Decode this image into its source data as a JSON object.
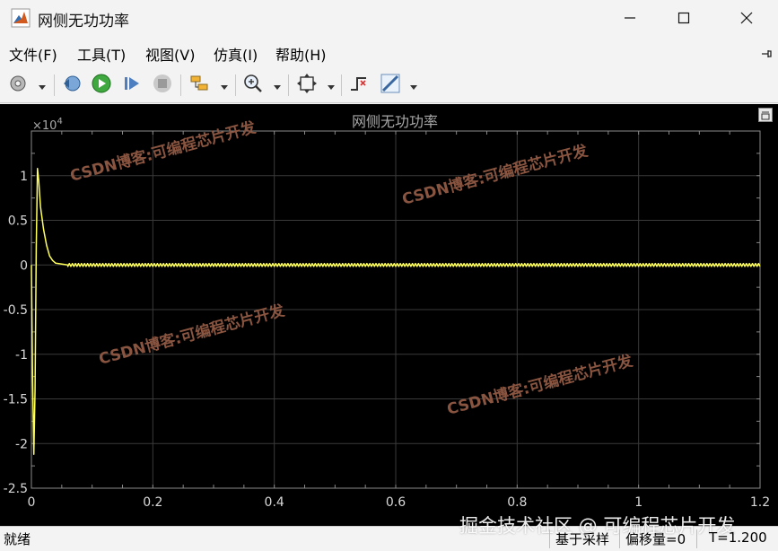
{
  "window": {
    "title": "网侧无功功率",
    "controls": [
      "minimize-icon",
      "maximize-icon",
      "close-icon"
    ]
  },
  "menu": {
    "items": [
      "文件(F)",
      "工具(T)",
      "视图(V)",
      "仿真(I)",
      "帮助(H)"
    ],
    "pin_icon": "pin-icon"
  },
  "toolbar": {
    "buttons": [
      "settings-icon",
      "step-back-icon",
      "run-icon",
      "step-forward-icon",
      "stop-icon",
      "highlight-icon",
      "zoom-icon",
      "fit-view-icon",
      "triggers-icon",
      "cursor-measure-icon"
    ]
  },
  "colors": {
    "signal": "#ffff5a",
    "plot_background": "#000000",
    "grid": "#3a3a3a",
    "axis_text": "#d8d8d8",
    "watermark": "#8a5540"
  },
  "chart_data": {
    "type": "line",
    "title": "网侧无功功率",
    "xlabel": "",
    "ylabel": "",
    "y_exponent_label": "×10",
    "y_exponent_power": "4",
    "xlim": [
      0,
      1.2
    ],
    "ylim": [
      -2.5,
      1.5
    ],
    "x_ticks": [
      "0",
      "0.2",
      "0.4",
      "0.6",
      "0.8",
      "1",
      "1.2"
    ],
    "y_ticks": [
      "1",
      "0.5",
      "0",
      "-0.5",
      "-1",
      "-1.5",
      "-2",
      "-2.5"
    ],
    "grid": true,
    "series": [
      {
        "x": [
          0,
          0.002,
          0.004,
          0.006,
          0.008,
          0.01,
          0.012,
          0.015,
          0.02,
          0.025,
          0.03,
          0.035,
          0.04,
          0.05,
          0.06,
          0.08,
          0.1,
          0.2,
          0.4,
          0.6,
          0.8,
          1.0,
          1.2
        ],
        "y": [
          0,
          -1.3,
          -2.12,
          -1.4,
          0.2,
          1.08,
          0.95,
          0.65,
          0.4,
          0.22,
          0.1,
          0.05,
          0.02,
          0.01,
          0.0,
          0.0,
          0.0,
          0.0,
          0.0,
          0.0,
          0.0,
          0.0,
          0.0
        ]
      }
    ],
    "watermarks": [
      "CSDN博客:可编程芯片开发",
      "CSDN博客:可编程芯片开发",
      "CSDN博客:可编程芯片开发",
      "CSDN博客:可编程芯片开发"
    ]
  },
  "status": {
    "left": "就绪",
    "sample_mode": "基于采样",
    "offset": "偏移量=0",
    "time": "T=1.200",
    "site_watermark": "掘金技术社区 @ 可编程芯片开发"
  }
}
